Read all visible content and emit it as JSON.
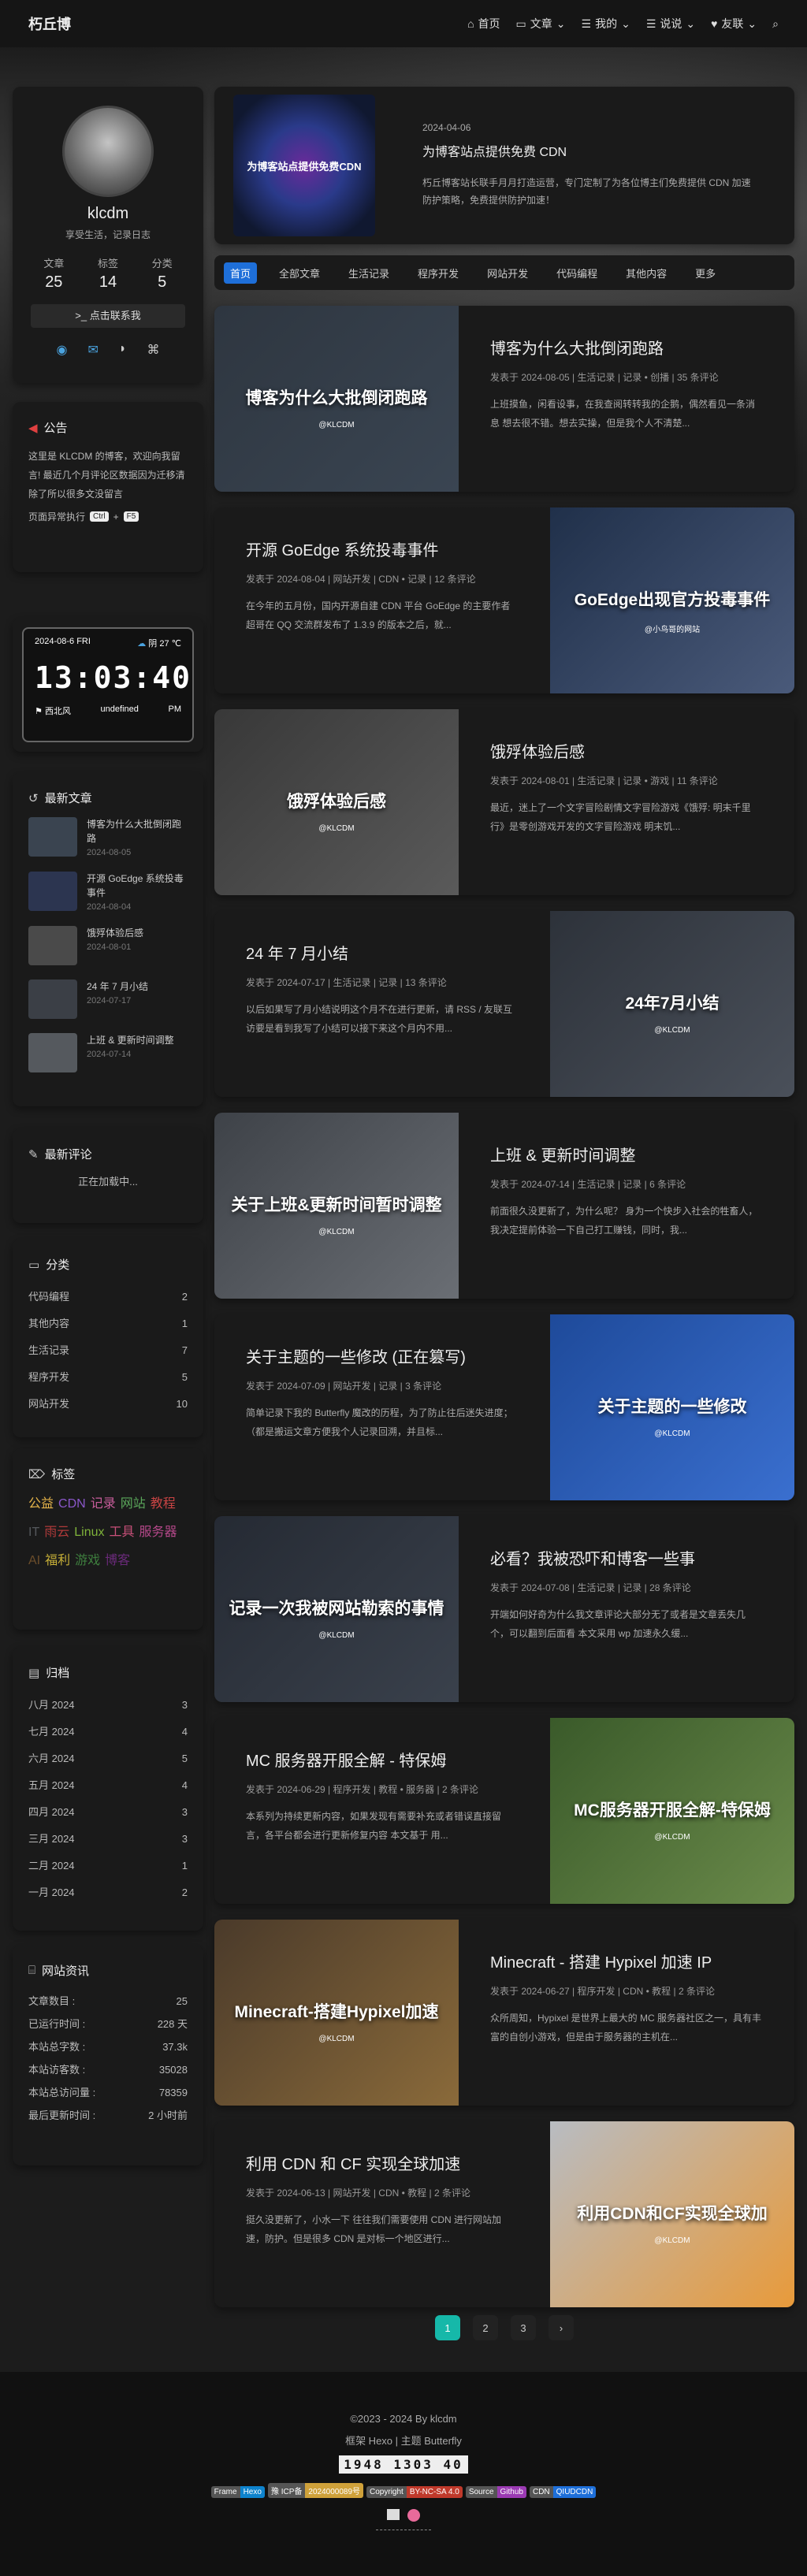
{
  "nav": {
    "brand": "朽丘博",
    "items": [
      {
        "icon": "home-icon",
        "label": "首页"
      },
      {
        "icon": "folder-icon",
        "label": "文章"
      },
      {
        "icon": "list-icon",
        "label": "我的"
      },
      {
        "icon": "list-icon",
        "label": "说说"
      },
      {
        "icon": "heart-icon",
        "label": "友联"
      }
    ]
  },
  "profile": {
    "name": "klcdm",
    "desc": "享受生活，记录日志",
    "stats": [
      {
        "label": "文章",
        "value": "25"
      },
      {
        "label": "标签",
        "value": "14"
      },
      {
        "label": "分类",
        "value": "5"
      }
    ],
    "contact": "点击联系我"
  },
  "notice": {
    "title": "公告",
    "text": "这里是 KLCDM 的博客，欢迎向我留言! 最近几个月评论区数据因为迁移清除了所以很多文没留言",
    "line2_a": "页面异常执行",
    "key1": "Ctrl",
    "plus": "+",
    "key2": "F5"
  },
  "clock": {
    "date": "2024-08-6 FRI",
    "weather": "阴 27 ℃",
    "time": "13:03:40",
    "wind": "西北风",
    "aq": "undefined",
    "pm": "PM"
  },
  "recent": {
    "title": "最新文章",
    "items": [
      {
        "name": "博客为什么大批倒闭跑路",
        "date": "2024-08-05",
        "color": "#3a4450"
      },
      {
        "name": "开源 GoEdge 系统投毒事件",
        "date": "2024-08-04",
        "color": "#2c3550"
      },
      {
        "name": "饿殍体验后感",
        "date": "2024-08-01",
        "color": "#4a4a4a"
      },
      {
        "name": "24 年 7 月小结",
        "date": "2024-07-17",
        "color": "#3b3f46"
      },
      {
        "name": "上班 & 更新时间调整",
        "date": "2024-07-14",
        "color": "#55595e"
      }
    ]
  },
  "comments": {
    "title": "最新评论",
    "loading": "正在加载中..."
  },
  "categories": {
    "title": "分类",
    "items": [
      {
        "name": "代码编程",
        "count": "2"
      },
      {
        "name": "其他内容",
        "count": "1"
      },
      {
        "name": "生活记录",
        "count": "7"
      },
      {
        "name": "程序开发",
        "count": "5"
      },
      {
        "name": "网站开发",
        "count": "10"
      }
    ]
  },
  "tags": {
    "title": "标签",
    "items": [
      {
        "name": "公益",
        "color": "#e4b34a"
      },
      {
        "name": "CDN",
        "color": "#8a57c9"
      },
      {
        "name": "记录",
        "color": "#c85d9b"
      },
      {
        "name": "网站",
        "color": "#5aa65a"
      },
      {
        "name": "教程",
        "color": "#c94444"
      },
      {
        "name": "IT",
        "color": "#55585c"
      },
      {
        "name": "雨云",
        "color": "#b03a3a"
      },
      {
        "name": "Linux",
        "color": "#7fb33a"
      },
      {
        "name": "工具",
        "color": "#c9507a"
      },
      {
        "name": "服务器",
        "color": "#b5488a"
      },
      {
        "name": "AI",
        "color": "#6b4d2a"
      },
      {
        "name": "福利",
        "color": "#c7b038"
      },
      {
        "name": "游戏",
        "color": "#3e7f3e"
      },
      {
        "name": "博客",
        "color": "#6a2a7a"
      }
    ]
  },
  "archives": {
    "title": "归档",
    "items": [
      {
        "name": "八月 2024",
        "count": "3"
      },
      {
        "name": "七月 2024",
        "count": "4"
      },
      {
        "name": "六月 2024",
        "count": "5"
      },
      {
        "name": "五月 2024",
        "count": "4"
      },
      {
        "name": "四月 2024",
        "count": "3"
      },
      {
        "name": "三月 2024",
        "count": "3"
      },
      {
        "name": "二月 2024",
        "count": "1"
      },
      {
        "name": "一月 2024",
        "count": "2"
      }
    ]
  },
  "siteinfo": {
    "title": "网站资讯",
    "items": [
      {
        "name": "文章数目 :",
        "value": "25"
      },
      {
        "name": "已运行时间 :",
        "value": "228 天"
      },
      {
        "name": "本站总字数 :",
        "value": "37.3k"
      },
      {
        "name": "本站访客数 :",
        "value": "35028"
      },
      {
        "name": "本站总访问量 :",
        "value": "78359"
      },
      {
        "name": "最后更新时间 :",
        "value": "2 小时前"
      }
    ]
  },
  "banner": {
    "date": "2024-04-06",
    "title": "为博客站点提供免费 CDN",
    "excerpt": "朽丘博客站长联手月月打造运营，专门定制了为各位博主们免费提供 CDN 加速防护策略，免费提供防护加速！",
    "thumb_text": "为博客站点提供免费CDN"
  },
  "tabs": [
    "首页",
    "全部文章",
    "生活记录",
    "程序开发",
    "网站开发",
    "代码编程",
    "其他内容",
    "更多"
  ],
  "posts": [
    {
      "title": "博客为什么大批倒闭跑路",
      "meta": "发表于 2024-08-05 | 生活记录 | 记录 • 创播 | 35 条评论",
      "excerpt": "上班摸鱼，闲看设事，在我查阅转转我的企鹅，偶然看见一条消息 想去很不错。想去实操，但是我个人不清楚...",
      "thumb": "博客为什么大批倒闭跑路",
      "wm": "@KLCDM",
      "c1": "#2e3640",
      "c2": "#3a4552"
    },
    {
      "title": "开源 GoEdge 系统投毒事件",
      "meta": "发表于 2024-08-04 | 网站开发 | CDN • 记录 | 12 条评论",
      "excerpt": "在今年的五月份，国内开源自建 CDN 平台 GoEdge 的主要作者超哥在 QQ 交流群发布了 1.3.9 的版本之后，就...",
      "thumb": "GoEdge出现官方投毒事件",
      "wm": "@小鸟哥的网站",
      "c1": "#20304a",
      "c2": "#4a5a7a"
    },
    {
      "title": "饿殍体验后感",
      "meta": "发表于 2024-08-01 | 生活记录 | 记录 • 游戏 | 11 条评论",
      "excerpt": "最近，迷上了一个文字冒险剧情文字冒险游戏《饿殍: 明末千里行》是零创游戏开发的文字冒险游戏 明末饥...",
      "thumb": "饿殍体验后感",
      "wm": "@KLCDM",
      "c1": "#383838",
      "c2": "#5a5a5a"
    },
    {
      "title": "24 年 7 月小结",
      "meta": "发表于 2024-07-17 | 生活记录 | 记录 | 13 条评论",
      "excerpt": "以后如果写了月小结说明这个月不在进行更新，请 RSS / 友联互访要是看到我写了小结可以接下来这个月内不用...",
      "thumb": "24年7月小结",
      "wm": "@KLCDM",
      "c1": "#2d323a",
      "c2": "#4a505a"
    },
    {
      "title": "上班 & 更新时间调整",
      "meta": "发表于 2024-07-14 | 生活记录 | 记录 | 6 条评论",
      "excerpt": "前面很久没更新了，为什么呢？ 身为一个快步入社会的牲畜人，我决定提前体验一下自己打工赚钱，同时，我...",
      "thumb": "关于上班&更新时间暂时调整",
      "wm": "@KLCDM",
      "c1": "#3e4248",
      "c2": "#6a6e74"
    },
    {
      "title": "关于主题的一些修改 (正在篡写)",
      "meta": "发表于 2024-07-09 | 网站开发 | 记录 | 3 条评论",
      "excerpt": "简单记录下我的 Butterfly 魔改的历程，为了防止往后迷失进度；（都是搬运文章方便我个人记录回溯，并且标...",
      "thumb": "关于主题的一些修改",
      "wm": "@KLCDM",
      "c1": "#1e4a9a",
      "c2": "#3a6fcf"
    },
    {
      "title": "必看？我被恐吓和博客一些事",
      "meta": "发表于 2024-07-08 | 生活记录 | 记录 | 28 条评论",
      "excerpt": "开端如何好奇为什么我文章评论大部分无了或者是文章丢失几个，可以翻到后面看 本文采用 wp 加速永久缓...",
      "thumb": "记录一次我被网站勒索的事情",
      "wm": "@KLCDM",
      "c1": "#252a33",
      "c2": "#3a414c"
    },
    {
      "title": "MC 服务器开服全解 - 特保姆",
      "meta": "发表于 2024-06-29 | 程序开发 | 教程 • 服务器 | 2 条评论",
      "excerpt": "本系列为持续更新内容，如果发现有需要补充或者错误直接留言，各平台都会进行更新修复内容 本文基于 用...",
      "thumb": "MC服务器开服全解-特保姆",
      "wm": "@KLCDM",
      "c1": "#3a5a2a",
      "c2": "#6a8a4a"
    },
    {
      "title": "Minecraft - 搭建 Hypixel 加速 IP",
      "meta": "发表于 2024-06-27 | 程序开发 | CDN • 教程 | 2 条评论",
      "excerpt": "众所周知，Hypixel 是世界上最大的 MC 服务器社区之一，具有丰富的自创小游戏，但是由于服务器的主机在...",
      "thumb": "Minecraft-搭建Hypixel加速",
      "wm": "@KLCDM",
      "c1": "#4a3a2a",
      "c2": "#8a6a3a"
    },
    {
      "title": "利用 CDN 和 CF 实现全球加速",
      "meta": "发表于 2024-06-13 | 网站开发 | CDN • 教程 | 2 条评论",
      "excerpt": "挺久没更新了，小水一下 往往我们需要使用 CDN 进行网站加速，防护。但是很多 CDN 是对标一个地区进行...",
      "thumb": "利用CDN和CF实现全球加",
      "wm": "@KLCDM",
      "c1": "#b8bcc2",
      "c2": "#e89a3a"
    }
  ],
  "pager": [
    "1",
    "2",
    "3",
    "›"
  ],
  "footer": {
    "copy": "©2023 - 2024 By klcdm",
    "frame": "框架 Hexo | 主题 Butterfly",
    "counter": "1948 1303 40",
    "badges": [
      {
        "l": "Frame",
        "r": "Hexo",
        "c": "#0e83cd"
      },
      {
        "l": "豫 ICP备",
        "r": "2024000089号",
        "c": "#cfa13a"
      },
      {
        "l": "Copyright",
        "r": "BY-NC-SA 4.0",
        "c": "#c0392b"
      },
      {
        "l": "Source",
        "r": "Github",
        "c": "#9b3ab3"
      },
      {
        "l": "CDN",
        "r": "QIUDCDN",
        "c": "#1e6fd9"
      }
    ]
  }
}
